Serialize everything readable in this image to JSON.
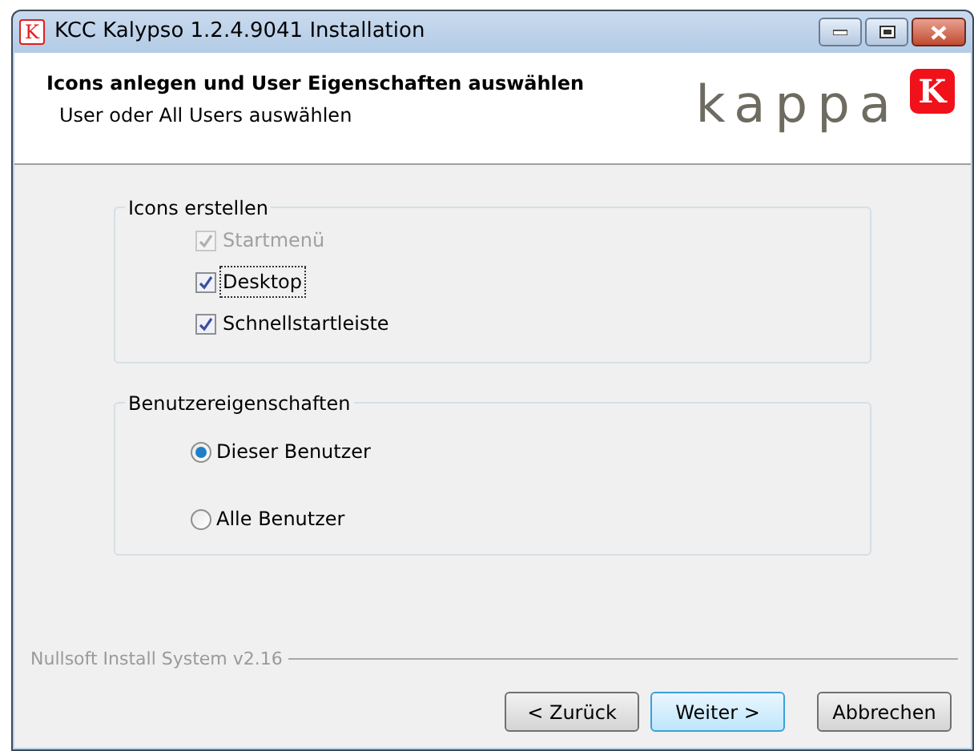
{
  "window": {
    "title": "KCC Kalypso 1.2.4.9041 Installation",
    "icon_letter": "K"
  },
  "header": {
    "title": "Icons anlegen und User Eigenschaften auswählen",
    "subtitle": "User oder All Users auswählen",
    "logo_text": "kappa",
    "logo_letter": "K"
  },
  "icons_group": {
    "title": "Icons erstellen",
    "options": [
      {
        "label": "Startmenü",
        "checked": true,
        "disabled": true,
        "focused": false
      },
      {
        "label": "Desktop",
        "checked": true,
        "disabled": false,
        "focused": true
      },
      {
        "label": "Schnellstartleiste",
        "checked": true,
        "disabled": false,
        "focused": false
      }
    ]
  },
  "user_group": {
    "title": "Benutzereigenschaften",
    "options": [
      {
        "label": "Dieser Benutzer",
        "selected": true
      },
      {
        "label": "Alle Benutzer",
        "selected": false
      }
    ]
  },
  "branding": "Nullsoft Install System v2.16",
  "buttons": [
    {
      "label": "< Zurück",
      "default": false
    },
    {
      "label": "Weiter >",
      "default": true
    },
    {
      "label": "Abbrechen",
      "default": false
    }
  ]
}
